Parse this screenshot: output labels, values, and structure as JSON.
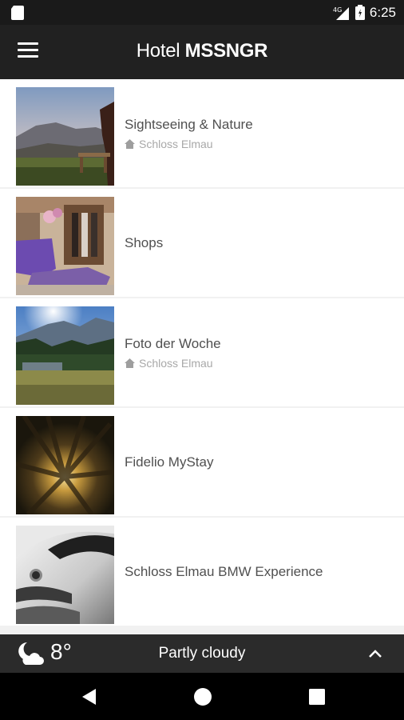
{
  "status_bar": {
    "time": "6:25",
    "network": "4G"
  },
  "app_bar": {
    "title_prefix": "Hotel",
    "title_brand": "MSSNGR"
  },
  "list_items": [
    {
      "title": "Sightseeing & Nature",
      "subtitle": "Schloss Elmau"
    },
    {
      "title": "Shops",
      "subtitle": ""
    },
    {
      "title": "Foto der Woche",
      "subtitle": "Schloss Elmau"
    },
    {
      "title": "Fidelio MyStay",
      "subtitle": ""
    },
    {
      "title": "Schloss Elmau BMW Experience",
      "subtitle": ""
    }
  ],
  "weather": {
    "temperature": "8°",
    "condition": "Partly cloudy"
  },
  "colors": {
    "app_bar": "#212121",
    "status_bar": "#1a1a1a",
    "weather_bar": "#2b2b2b",
    "nav_bar": "#000000"
  }
}
